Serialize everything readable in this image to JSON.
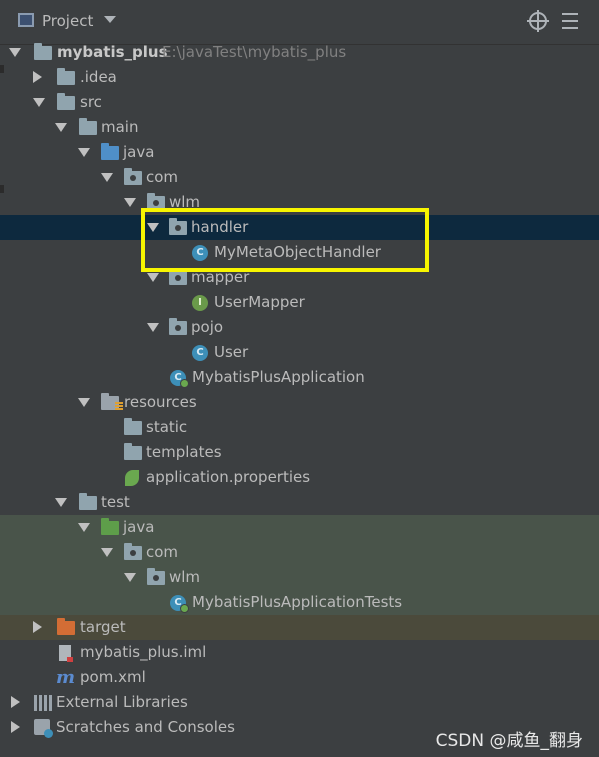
{
  "header": {
    "title": "Project",
    "icons": [
      "project-icon",
      "chevron-down-icon",
      "locate-target-icon",
      "collapse-all-icon"
    ]
  },
  "tree": {
    "rows": [
      {
        "label": "mybatis_plus",
        "path": "E:\\javaTest\\mybatis_plus",
        "icon": "module-folder-icon",
        "expanded": true
      },
      {
        "label": ".idea",
        "icon": "folder-icon",
        "expanded": false
      },
      {
        "label": "src",
        "icon": "folder-icon",
        "expanded": true
      },
      {
        "label": "main",
        "icon": "folder-icon",
        "expanded": true
      },
      {
        "label": "java",
        "icon": "source-folder-icon",
        "expanded": true
      },
      {
        "label": "com",
        "icon": "package-icon",
        "expanded": true
      },
      {
        "label": "wlm",
        "icon": "package-icon",
        "expanded": true
      },
      {
        "label": "handler",
        "icon": "package-icon",
        "expanded": true,
        "selected": true
      },
      {
        "label": "MyMetaObjectHandler",
        "icon": "class-icon",
        "icon_letter": "C"
      },
      {
        "label": "mapper",
        "icon": "package-icon",
        "expanded": true
      },
      {
        "label": "UserMapper",
        "icon": "interface-icon",
        "icon_letter": "I"
      },
      {
        "label": "pojo",
        "icon": "package-icon",
        "expanded": true
      },
      {
        "label": "User",
        "icon": "class-icon",
        "icon_letter": "C"
      },
      {
        "label": "MybatisPlusApplication",
        "icon": "spring-boot-class-icon",
        "icon_letter": "C"
      },
      {
        "label": "resources",
        "icon": "resources-folder-icon",
        "expanded": true
      },
      {
        "label": "static",
        "icon": "folder-icon"
      },
      {
        "label": "templates",
        "icon": "folder-icon"
      },
      {
        "label": "application.properties",
        "icon": "spring-properties-icon"
      },
      {
        "label": "test",
        "icon": "folder-icon",
        "expanded": true
      },
      {
        "label": "java",
        "icon": "test-source-folder-icon",
        "expanded": true
      },
      {
        "label": "com",
        "icon": "package-icon",
        "expanded": true
      },
      {
        "label": "wlm",
        "icon": "package-icon",
        "expanded": true
      },
      {
        "label": "MybatisPlusApplicationTests",
        "icon": "spring-boot-class-icon",
        "icon_letter": "C"
      },
      {
        "label": "target",
        "icon": "excluded-folder-icon",
        "expanded": false
      },
      {
        "label": "mybatis_plus.iml",
        "icon": "iml-file-icon"
      },
      {
        "label": "pom.xml",
        "icon": "maven-icon",
        "icon_letter": "m"
      },
      {
        "label": "External Libraries",
        "icon": "libraries-icon",
        "expanded": false
      },
      {
        "label": "Scratches and Consoles",
        "icon": "scratches-icon",
        "expanded": false
      }
    ]
  },
  "highlight": {
    "color": "#f7f500"
  },
  "colors": {
    "panel_bg": "#3c3f41",
    "selected_bg": "#0d293e",
    "test_bg": "#49544a",
    "excluded_bg": "#4b4a3b"
  },
  "watermark": "CSDN @咸鱼_翻身"
}
